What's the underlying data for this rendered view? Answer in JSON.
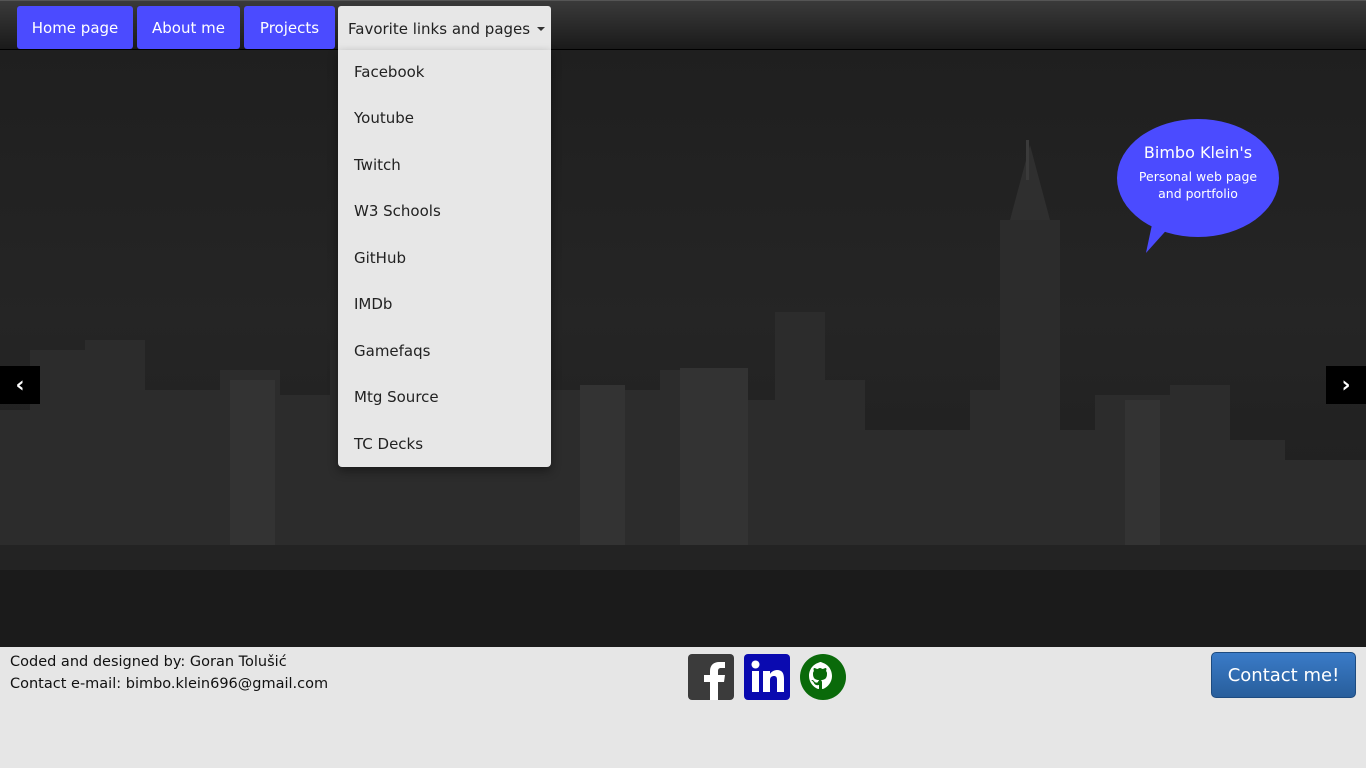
{
  "nav": {
    "home": "Home page",
    "about": "About me",
    "projects": "Projects",
    "favorites": "Favorite links and pages"
  },
  "dropdown": {
    "items": [
      "Facebook",
      "Youtube",
      "Twitch",
      "W3 Schools",
      "GitHub",
      "IMDb",
      "Gamefaqs",
      "Mtg Source",
      "TC Decks"
    ]
  },
  "carousel": {
    "prev": "‹",
    "next": "›"
  },
  "bubble": {
    "title": "Bimbo Klein's",
    "subtitle": "Personal web page and portfolio"
  },
  "footer": {
    "credit": "Coded and designed by: Goran Tolušić",
    "contact": "Contact e-mail: bimbo.klein696@gmail.com",
    "contact_button": "Contact me!"
  },
  "social": [
    "facebook-icon",
    "linkedin-icon",
    "github-icon"
  ],
  "colors": {
    "accent": "#4b4bff",
    "contact_button": "#2f6db4",
    "footer_bg": "#e6e6e6"
  }
}
